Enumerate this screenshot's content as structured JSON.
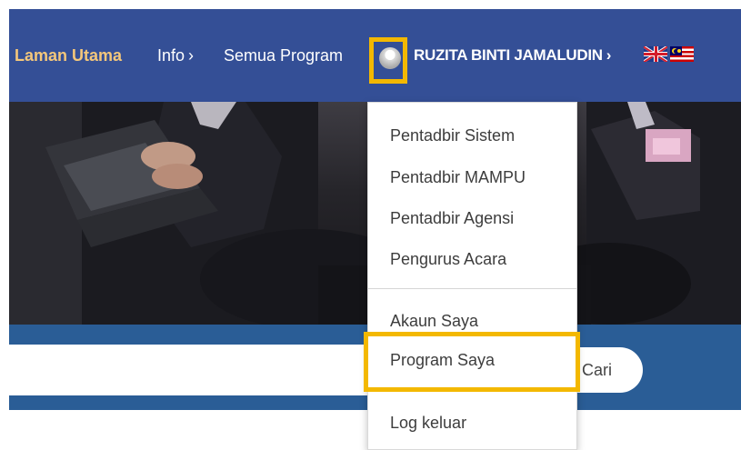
{
  "nav": {
    "home_label": "Laman Utama",
    "info_label": "Info",
    "programs_label": "Semua Program",
    "user_name": "RUZITA BINTI JAMALUDIN",
    "chevron": "›"
  },
  "icons": {
    "avatar": "user-avatar-icon",
    "flag_en": "uk-flag-icon",
    "flag_ms": "malaysia-flag-icon"
  },
  "search": {
    "input_value": "",
    "button_label": "Cari"
  },
  "user_menu": {
    "items": [
      {
        "label": "Pentadbir Sistem"
      },
      {
        "label": "Pentadbir MAMPU"
      },
      {
        "label": "Pentadbir Agensi"
      },
      {
        "label": "Pengurus Acara"
      },
      {
        "label": "Akaun Saya"
      },
      {
        "label": "Program Saya"
      },
      {
        "label": "Log keluar"
      }
    ]
  },
  "colors": {
    "nav_bg": "#344f96",
    "home_text": "#f4c77b",
    "band_bg": "#2a5d96",
    "highlight": "#f3b800"
  }
}
